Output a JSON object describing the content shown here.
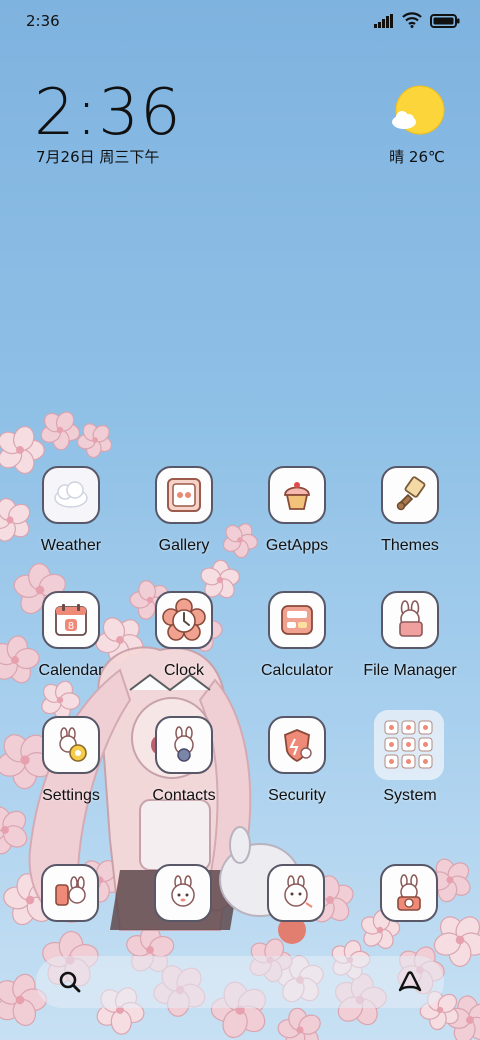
{
  "status_bar": {
    "time": "2:36",
    "signal_icon": "signal-icon",
    "wifi_icon": "wifi-icon",
    "battery_icon": "battery-icon"
  },
  "clock_widget": {
    "time": "2:36",
    "date": "7月26日 周三下午"
  },
  "weather_widget": {
    "icon": "sun-cloud-icon",
    "text": "晴 26℃"
  },
  "apps": [
    {
      "label": "Weather",
      "icon": "cloud-icon"
    },
    {
      "label": "Gallery",
      "icon": "gallery-icon"
    },
    {
      "label": "GetApps",
      "icon": "cupcake-icon"
    },
    {
      "label": "Themes",
      "icon": "brush-icon"
    },
    {
      "label": "Calendar",
      "icon": "calendar-icon",
      "day": "8"
    },
    {
      "label": "Clock",
      "icon": "flower-clock-icon"
    },
    {
      "label": "Calculator",
      "icon": "calculator-icon"
    },
    {
      "label": "File Manager",
      "icon": "bunny-folder-icon"
    },
    {
      "label": "Settings",
      "icon": "bunny-gear-icon"
    },
    {
      "label": "Contacts",
      "icon": "bunny-contacts-icon"
    },
    {
      "label": "Security",
      "icon": "shield-bunny-icon"
    },
    {
      "label": "System",
      "icon": "folder-icon"
    }
  ],
  "dock": [
    {
      "icon": "phone-bunny-icon"
    },
    {
      "icon": "message-bunny-icon"
    },
    {
      "icon": "browser-bunny-icon"
    },
    {
      "icon": "camera-bunny-icon"
    }
  ],
  "search_bar": {
    "search_icon": "search-icon",
    "assistant_icon": "assistant-icon"
  },
  "colors": {
    "sky_top": "#7fb3df",
    "sky_bottom": "#c7e0f3",
    "blossom": "#f4cfd7",
    "icon_border": "#585868",
    "icon_accent": "#e98a73"
  }
}
